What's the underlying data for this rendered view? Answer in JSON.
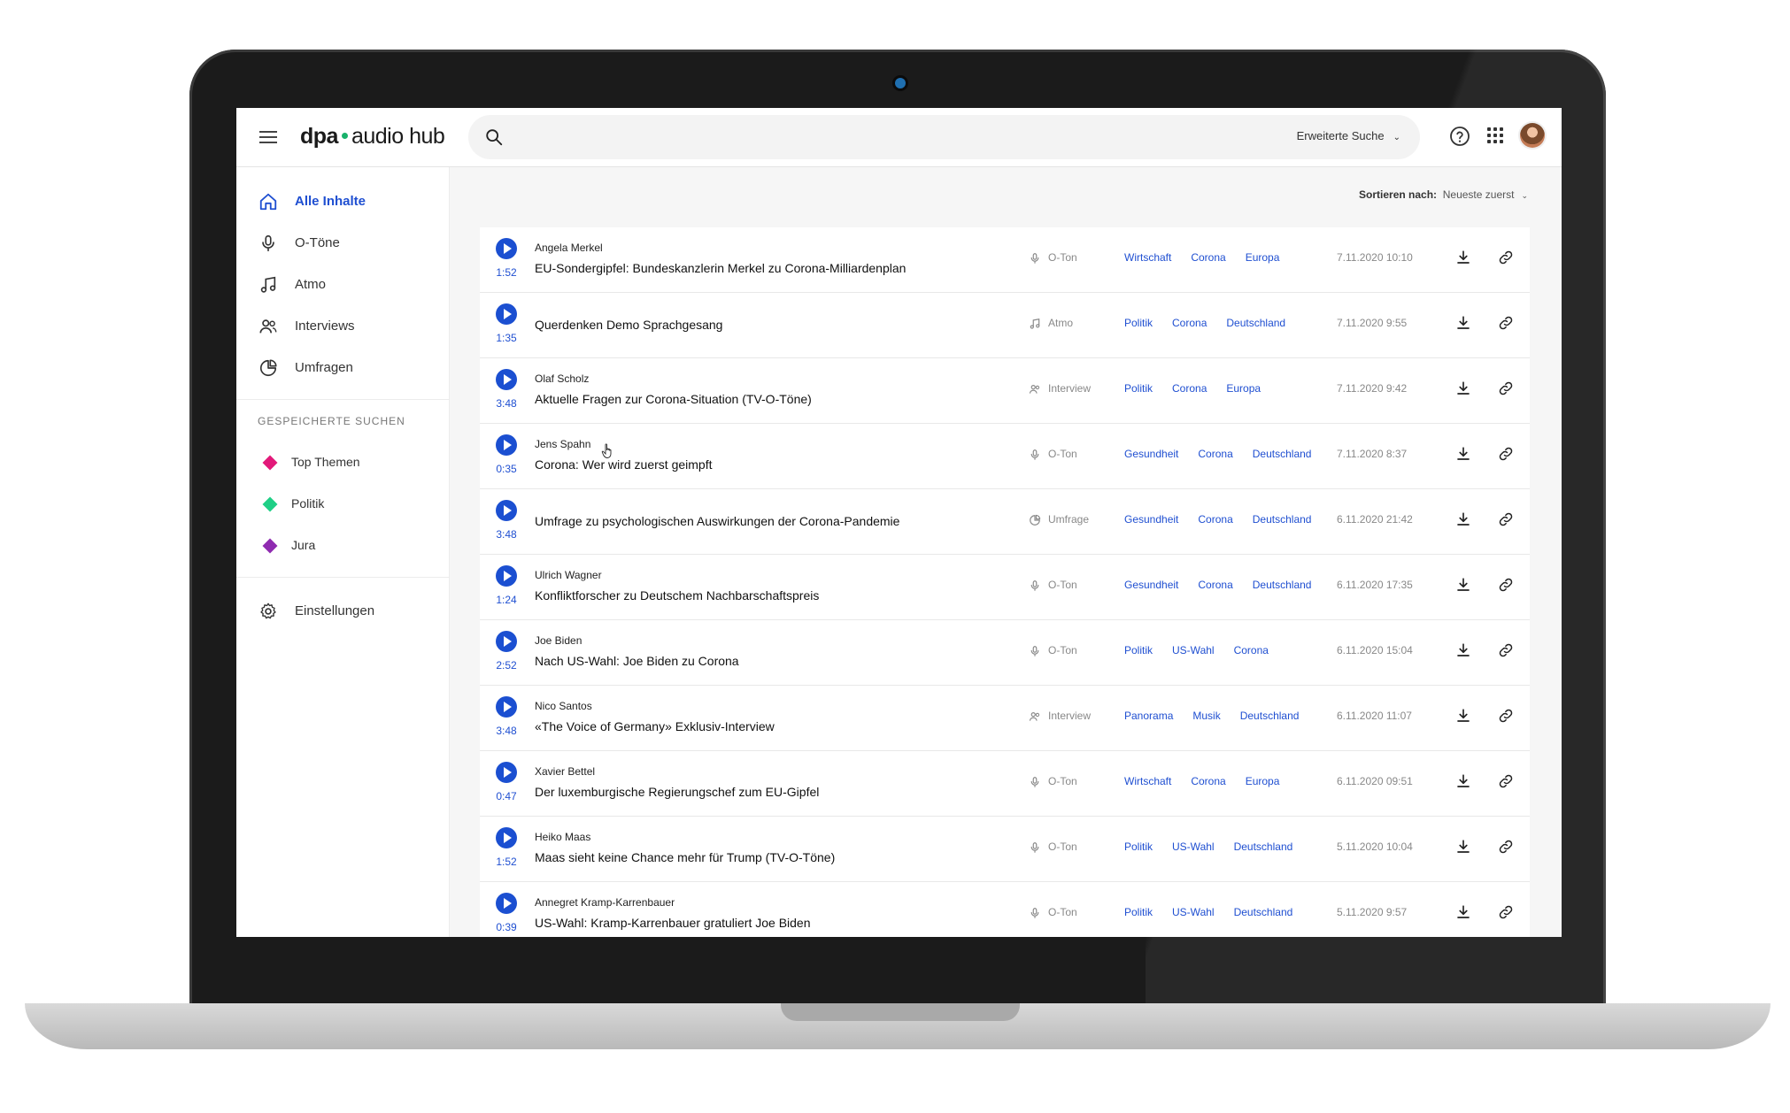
{
  "app": {
    "logo_left": "dpa",
    "logo_right": "audio hub"
  },
  "search": {
    "placeholder": "",
    "advanced_label": "Erweiterte Suche"
  },
  "sidebar": {
    "nav": [
      {
        "label": "Alle Inhalte",
        "icon": "home-icon",
        "active": true
      },
      {
        "label": "O-Töne",
        "icon": "microphone-icon"
      },
      {
        "label": "Atmo",
        "icon": "music-note-icon"
      },
      {
        "label": "Interviews",
        "icon": "people-icon"
      },
      {
        "label": "Umfragen",
        "icon": "pie-chart-icon"
      }
    ],
    "saved_title": "GESPEICHERTE SUCHEN",
    "saved": [
      {
        "label": "Top Themen",
        "color": "#e2197a"
      },
      {
        "label": "Politik",
        "color": "#1fcf86"
      },
      {
        "label": "Jura",
        "color": "#8f2bb0"
      }
    ],
    "settings_label": "Einstellungen"
  },
  "sort": {
    "label": "Sortieren nach:",
    "value": "Neueste zuerst"
  },
  "items": [
    {
      "duration": "1:52",
      "speaker": "Angela Merkel",
      "title": "EU-Sondergipfel: Bundeskanzlerin Merkel zu Corona-Milliardenplan",
      "type": "O-Ton",
      "tags": [
        "Wirtschaft",
        "Corona",
        "Europa"
      ],
      "date": "7.11.2020 10:10"
    },
    {
      "duration": "1:35",
      "speaker": "",
      "title": "Querdenken Demo Sprachgesang",
      "type": "Atmo",
      "tags": [
        "Politik",
        "Corona",
        "Deutschland"
      ],
      "date": "7.11.2020 9:55"
    },
    {
      "duration": "3:48",
      "speaker": "Olaf Scholz",
      "title": "Aktuelle Fragen zur Corona-Situation (TV-O-Töne)",
      "type": "Interview",
      "tags": [
        "Politik",
        "Corona",
        "Europa"
      ],
      "date": "7.11.2020 9:42"
    },
    {
      "duration": "0:35",
      "speaker": "Jens Spahn",
      "title": "Corona: Wer wird zuerst geimpft",
      "type": "O-Ton",
      "tags": [
        "Gesundheit",
        "Corona",
        "Deutschland"
      ],
      "date": "7.11.2020 8:37"
    },
    {
      "duration": "3:48",
      "speaker": "",
      "title": "Umfrage zu psychologischen Auswirkungen der Corona-Pandemie",
      "type": "Umfrage",
      "tags": [
        "Gesundheit",
        "Corona",
        "Deutschland"
      ],
      "date": "6.11.2020 21:42"
    },
    {
      "duration": "1:24",
      "speaker": "Ulrich Wagner",
      "title": "Konfliktforscher zu Deutschem Nachbarschaftspreis",
      "type": "O-Ton",
      "tags": [
        "Gesundheit",
        "Corona",
        "Deutschland"
      ],
      "date": "6.11.2020 17:35"
    },
    {
      "duration": "2:52",
      "speaker": "Joe Biden",
      "title": "Nach US-Wahl: Joe Biden zu Corona",
      "type": "O-Ton",
      "tags": [
        "Politik",
        "US-Wahl",
        "Corona"
      ],
      "date": "6.11.2020 15:04"
    },
    {
      "duration": "3:48",
      "speaker": "Nico Santos",
      "title": "«The Voice of Germany» Exklusiv-Interview",
      "type": "Interview",
      "tags": [
        "Panorama",
        "Musik",
        "Deutschland"
      ],
      "date": "6.11.2020 11:07"
    },
    {
      "duration": "0:47",
      "speaker": "Xavier Bettel",
      "title": "Der luxemburgische Regierungschef zum EU-Gipfel",
      "type": "O-Ton",
      "tags": [
        "Wirtschaft",
        "Corona",
        "Europa"
      ],
      "date": "6.11.2020 09:51"
    },
    {
      "duration": "1:52",
      "speaker": "Heiko Maas",
      "title": "Maas sieht keine Chance mehr für Trump (TV-O-Töne)",
      "type": "O-Ton",
      "tags": [
        "Politik",
        "US-Wahl",
        "Deutschland"
      ],
      "date": "5.11.2020 10:04"
    },
    {
      "duration": "0:39",
      "speaker": "Annegret Kramp-Karrenbauer",
      "title": "US-Wahl: Kramp-Karrenbauer gratuliert Joe Biden",
      "type": "O-Ton",
      "tags": [
        "Politik",
        "US-Wahl",
        "Deutschland"
      ],
      "date": "5.11.2020 9:57"
    }
  ]
}
